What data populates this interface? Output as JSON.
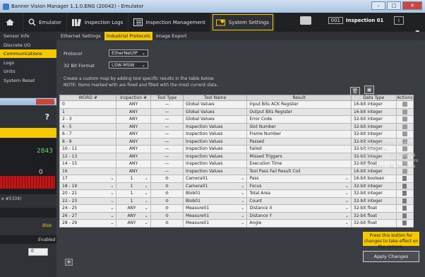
{
  "window": {
    "title": "Banner Vision Manager 1.1.0.ENG (20042) - Emulator"
  },
  "toolbar": {
    "emulator_label": "Emulator",
    "logs_label": "Inspection Logs",
    "management_label": "Inspection Management",
    "settings_label": "System Settings",
    "inspection_number": "001",
    "inspection_name": "Inspection 01",
    "help": "?"
  },
  "sidebar": {
    "items": [
      "Sensor Info",
      "Discrete I/O",
      "Communications",
      "Logs",
      "Units",
      "System Reset"
    ]
  },
  "tabs": [
    "Ethernet Settings",
    "Industrial Protocols",
    "Image Export"
  ],
  "form": {
    "protocol_label": "Protocol",
    "protocol_value": "EtherNet/IP",
    "format_label": "32 Bit Format",
    "format_value": "LSW-MSW",
    "note1": "Create a custom map by adding tool specific results in the table below.",
    "note2": "NOTE: Items marked with      are fixed and filled with the most current data."
  },
  "table": {
    "headers": [
      "WORD #",
      "Inspection #",
      "Tool Type",
      "Tool Name",
      "Result",
      "Data Type",
      "Actions"
    ],
    "rows": [
      [
        "0",
        "ANY",
        "—",
        "Global Values",
        "Input Bits ACK Register",
        "16-bit integer"
      ],
      [
        "1",
        "ANY",
        "—",
        "Global Values",
        "Output Bits Register",
        "16-bit integer"
      ],
      [
        "2 - 3",
        "ANY",
        "—",
        "Global Values",
        "Error Code",
        "32-bit integer"
      ],
      [
        "4 - 5",
        "ANY",
        "—",
        "Inspection Values",
        "Slot Number",
        "32-bit integer"
      ],
      [
        "6 - 7",
        "ANY",
        "—",
        "Inspection Values",
        "Frame Number",
        "32-bit integer"
      ],
      [
        "8 - 9",
        "ANY",
        "—",
        "Inspection Values",
        "Passed",
        "32-bit integer"
      ],
      [
        "10 - 11",
        "ANY",
        "—",
        "Inspection Values",
        "Failed",
        "32-bit integer"
      ],
      [
        "12 - 13",
        "ANY",
        "—",
        "Inspection Values",
        "Missed Triggers",
        "32-bit integer"
      ],
      [
        "14 - 15",
        "ANY",
        "—",
        "Inspection Values",
        "Execution Time",
        "32-bit float"
      ],
      [
        "16",
        "ANY",
        "—",
        "Inspection Values",
        "Tool Pass Fail Result Coil",
        "16-bit integer"
      ],
      [
        "17",
        "1",
        "",
        "Camera01",
        "Pass",
        "16-bit boolean"
      ],
      [
        "18 - 19",
        "1",
        "",
        "Camera01",
        "Focus",
        "32-bit integer"
      ],
      [
        "20 - 21",
        "1",
        "",
        "Blob01",
        "Total Area",
        "32-bit integer"
      ],
      [
        "22 - 23",
        "1",
        "",
        "Blob01",
        "Count",
        "32-bit integer"
      ],
      [
        "24 - 25",
        "ANY",
        "",
        "Measure01",
        "Distance X",
        "32-bit float"
      ],
      [
        "26 - 27",
        "ANY",
        "",
        "Measure01",
        "Distance Y",
        "32-bit float"
      ],
      [
        "28 - 29",
        "ANY",
        "",
        "Measure01",
        "Angle",
        "32-bit float"
      ]
    ]
  },
  "plc": {
    "title": "PLC Input/Sensor Output Assemblies:",
    "lines": [
      "100 (0x64) - 30 Registers",
      "101 (0x65) - 240 Registers",
      "102 (0x66) - 60 Registers"
    ]
  },
  "apply": {
    "tip": "Press this button for changes to take effect on the camera.",
    "label": "Apply Changes"
  },
  "floating": {
    "help": "?",
    "val1": "2843",
    "val2": "0",
    "frag1": "e #5339)",
    "frag2": "Blob",
    "frag3": "Enabled",
    "frag4": "0"
  },
  "colors": {
    "accent": "#f5c800",
    "background": "#3a3d42"
  }
}
